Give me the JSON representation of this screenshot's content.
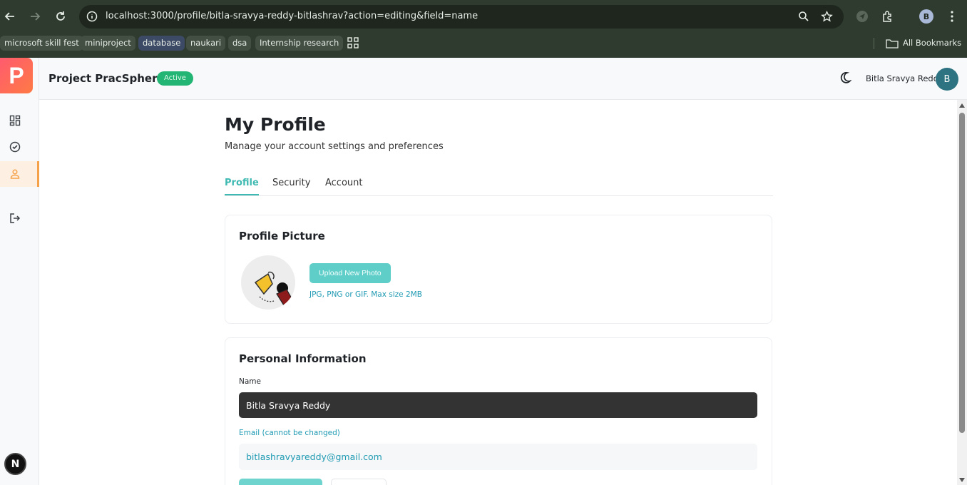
{
  "browser": {
    "url": "localhost:3000/profile/bitla-sravya-reddy-bitlashrav?action=editing&field=name",
    "profile_initial": "B",
    "bookmarks": [
      "microsoft skill fest",
      "miniproject",
      "database",
      "naukari",
      "dsa",
      "Internship research"
    ],
    "all_bookmarks": "All Bookmarks"
  },
  "sidebar": {
    "logo": "P",
    "items": [
      {
        "icon": "dashboard-icon"
      },
      {
        "icon": "check-circle-icon"
      },
      {
        "icon": "user-icon",
        "active": true
      },
      {
        "icon": "logout-icon"
      }
    ],
    "bottom_badge": "N"
  },
  "header": {
    "title": "Project PracSphere",
    "status_badge": "Active",
    "user_name": "Bitla Sravya Reddy",
    "avatar_initial": "B"
  },
  "page": {
    "title": "My Profile",
    "subtitle": "Manage your account settings and preferences",
    "tabs": [
      {
        "label": "Profile",
        "active": true
      },
      {
        "label": "Security",
        "active": false
      },
      {
        "label": "Account",
        "active": false
      }
    ]
  },
  "profile_picture": {
    "title": "Profile Picture",
    "upload_label": "Upload New Photo",
    "hint": "JPG, PNG or GIF. Max size 2MB"
  },
  "personal_info": {
    "title": "Personal Information",
    "name_label": "Name",
    "name_value": "Bitla Sravya Reddy",
    "email_label": "Email (cannot be changed)",
    "email_value": "bitlashravyareddy@gmail.com"
  },
  "colors": {
    "accent": "#3fbab2",
    "active_badge": "#22b573",
    "logo_gradient_start": "#ff5b6e",
    "logo_gradient_end": "#ff7a45"
  }
}
